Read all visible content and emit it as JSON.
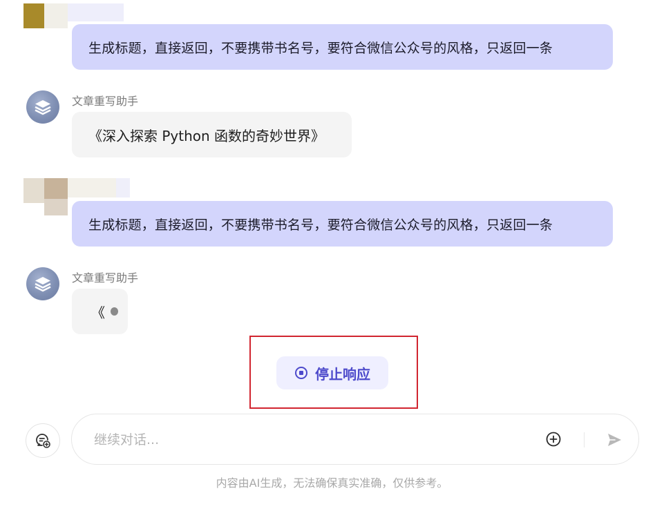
{
  "messages": [
    {
      "role": "user",
      "text": "生成标题，直接返回，不要携带书名号，要符合微信公众号的风格，只返回一条"
    },
    {
      "role": "assistant",
      "name": "文章重写助手",
      "text": "《深入探索 Python 函数的奇妙世界》"
    },
    {
      "role": "user",
      "text": "生成标题，直接返回，不要携带书名号，要符合微信公众号的风格，只返回一条"
    },
    {
      "role": "assistant",
      "name": "文章重写助手",
      "text": "《"
    }
  ],
  "stop_button": {
    "label": "停止响应",
    "icon": "stop-circle-icon"
  },
  "composer": {
    "placeholder": "继续对话...",
    "history_icon": "chat-history-icon",
    "attach_icon": "plus-circle-icon",
    "send_icon": "send-arrow-icon"
  },
  "disclaimer": "内容由AI生成，无法确保真实准确，仅供参考。",
  "colors": {
    "user_bubble": "#d3d5fc",
    "bot_bubble": "#f4f4f4",
    "accent": "#4d4acb",
    "stop_bg": "#efefff",
    "highlight": "#d1242f"
  }
}
